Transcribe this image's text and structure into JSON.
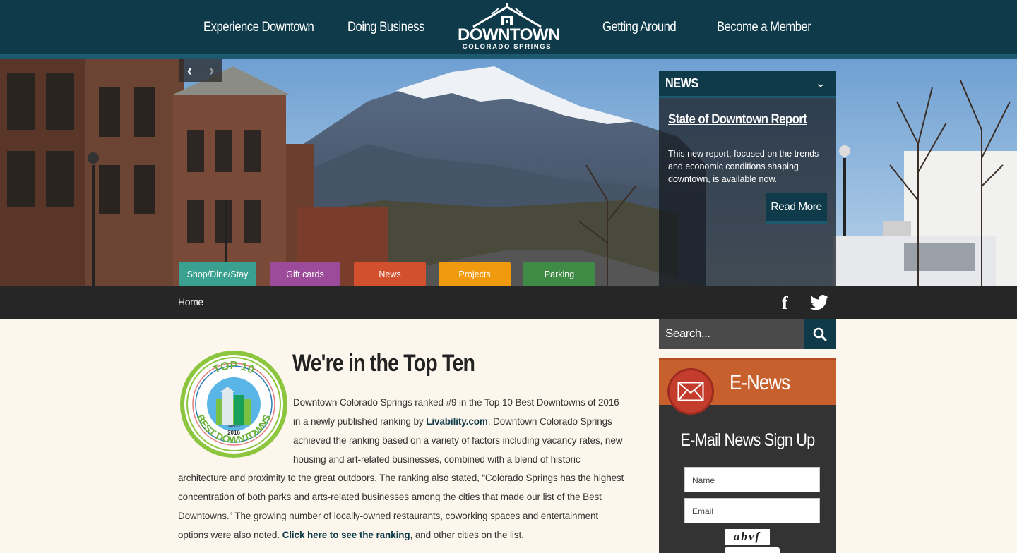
{
  "header": {
    "nav": [
      "Experience Downtown",
      "Doing Business",
      "Getting Around",
      "Become a Member"
    ],
    "logo": {
      "main": "DOWNTOWN",
      "sub": "COLORADO SPRINGS"
    }
  },
  "hero": {
    "news_panel": {
      "label": "NEWS",
      "title": "State of Downtown Report",
      "body": "This new report, focused on the trends and economic conditions shaping downtown, is available now.",
      "button": "Read More"
    },
    "quick_links": [
      {
        "label": "Shop/Dine/Stay",
        "color": "#3aa090"
      },
      {
        "label": "Gift cards",
        "color": "#9c4a9a"
      },
      {
        "label": "News",
        "color": "#d2502d"
      },
      {
        "label": "Projects",
        "color": "#f29a0e"
      },
      {
        "label": "Parking",
        "color": "#3f8a45"
      }
    ]
  },
  "breadcrumb": {
    "home": "Home"
  },
  "search": {
    "placeholder": "Search..."
  },
  "enews": {
    "title": "E-News",
    "subtitle": "E-Mail News Sign Up",
    "name_placeholder": "Name",
    "email_placeholder": "Email",
    "captcha": "abvf"
  },
  "article": {
    "title": "We're in the Top Ten",
    "p1_text1": "Downtown Colorado Springs ranked #9 in the Top 10 Best Downtowns of 2016",
    "p1_text2": "in a newly published ranking by ",
    "p1_link": "Livability.com",
    "p1_text3": ". Downtown Colorado Springs",
    "p1_text4": "achieved the ranking based on a variety of factors including vacancy rates, new",
    "p1_text5": "housing and art-related businesses, combined with a blend of historic",
    "p2_text1": "architecture and proximity to the great outdoors. The ranking also stated, “Colorado Springs has the highest",
    "p2_text2": "concentration of both parks and arts-related businesses among the cities that made our list of the Best",
    "p2_text3": "Downtowns.” The growing number of locally-owned restaurants, coworking spaces and entertainment",
    "p2_text4": "options were also noted. ",
    "p2_link": "Click here to see the ranking",
    "p2_text5": ", and other cities on the list."
  },
  "badge": {
    "top": "TOP 10",
    "bottom": "BEST DOWNTOWNS",
    "year": "2016",
    "brand": "LIVABILITY"
  }
}
